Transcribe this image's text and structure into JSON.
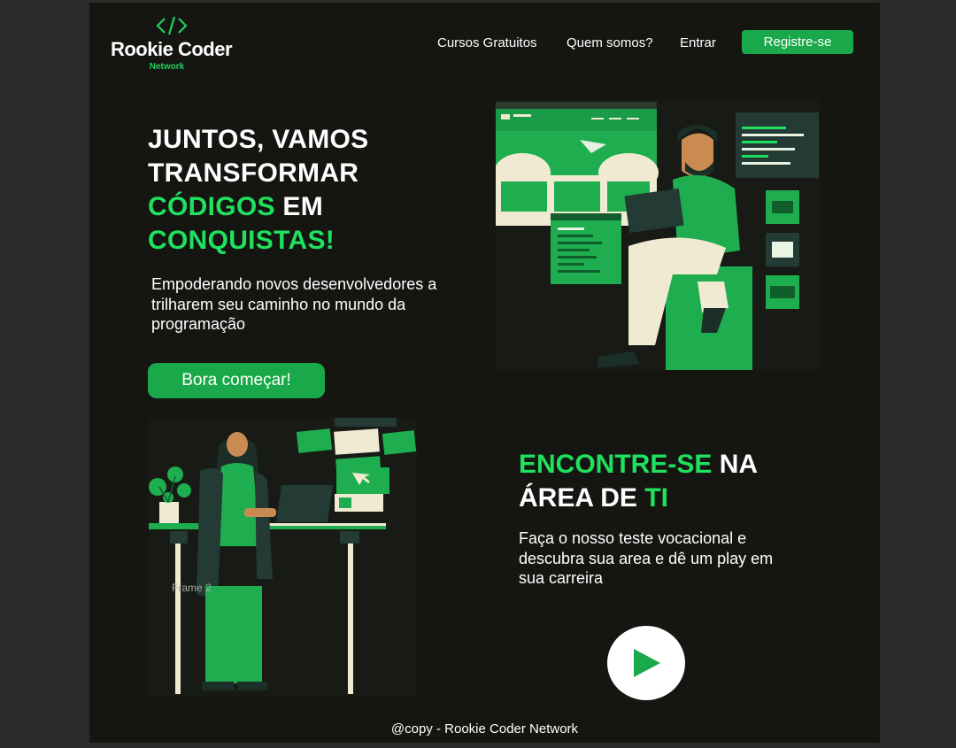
{
  "header": {
    "logo_title": "Rookie Coder",
    "logo_subtitle": "Network",
    "nav": [
      "Cursos Gratuitos",
      "Quem somos?",
      "Entrar"
    ],
    "register_label": "Registre-se"
  },
  "hero": {
    "title_line1": "JUNTOS, VAMOS",
    "title_line2": "TRANSFORMAR",
    "title_green1": "CÓDIGOS",
    "title_word_em": " EM",
    "title_green2": "CONQUISTAS!",
    "subtitle": "Empoderando novos desenvolvedores a trilharem seu caminho no mundo da programação",
    "cta_label": "Bora começar!"
  },
  "frame_label": "Frame 2",
  "section": {
    "title_green1": "ENCONTRE-SE",
    "title_white1": " NA",
    "title_white2": "ÁREA DE ",
    "title_green2": "TI",
    "subtitle": "Faça o nosso teste vocacional e descubra sua area e dê um play em sua carreira"
  },
  "footer": {
    "text": "@copy - Rookie Coder Network"
  },
  "colors": {
    "accent": "#1fe15e",
    "button": "#1aa94a",
    "background": "#151612"
  },
  "icons": [
    "code-brackets-icon",
    "play-icon"
  ]
}
